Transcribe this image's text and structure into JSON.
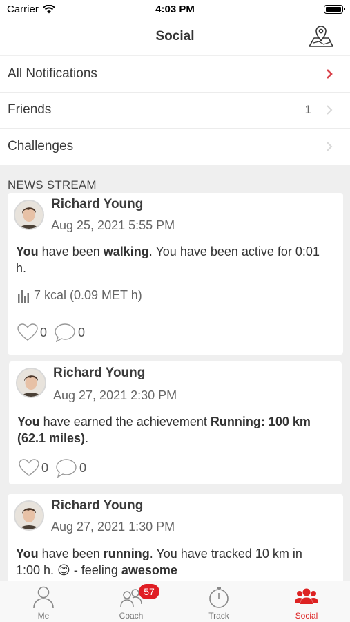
{
  "status_bar": {
    "carrier": "Carrier",
    "time": "4:03 PM"
  },
  "nav": {
    "title": "Social",
    "map_icon": "map-pin-icon"
  },
  "menu": [
    {
      "label": "All Notifications",
      "count": "",
      "chevron_color": "#d9434b"
    },
    {
      "label": "Friends",
      "count": "1",
      "chevron_color": "#d8d8d8"
    },
    {
      "label": "Challenges",
      "count": "",
      "chevron_color": "#d8d8d8"
    }
  ],
  "news_stream": {
    "label": "NEWS STREAM",
    "posts": [
      {
        "author": "Richard Young",
        "date": "Aug 25, 2021 5:55 PM",
        "text_parts": [
          "You",
          " have been ",
          "walking",
          ". You have been active for 0:01 h."
        ],
        "metric": "7 kcal (0.09 MET h)",
        "likes": "0",
        "comments": "0"
      },
      {
        "author": "Richard Young",
        "date": "Aug 27, 2021 2:30 PM",
        "text_parts": [
          "You",
          " have earned the achievement ",
          "Running: 100 km (62.1 miles)",
          "."
        ],
        "likes": "0",
        "comments": "0"
      },
      {
        "author": "Richard Young",
        "date": "Aug 27, 2021 1:30 PM",
        "text_parts": [
          "You",
          " have been ",
          "running",
          ". You have tracked 10 km in 1:00 h. ",
          "😊",
          " - feeling ",
          "awesome"
        ]
      }
    ]
  },
  "tabs": [
    {
      "label": "Me",
      "icon": "person-icon"
    },
    {
      "label": "Coach",
      "icon": "coach-icon",
      "badge": "57"
    },
    {
      "label": "Track",
      "icon": "stopwatch-icon"
    },
    {
      "label": "Social",
      "icon": "group-icon",
      "active": true
    }
  ],
  "colors": {
    "accent": "#d22222",
    "badge": "#e01e24",
    "background": "#efefef"
  }
}
